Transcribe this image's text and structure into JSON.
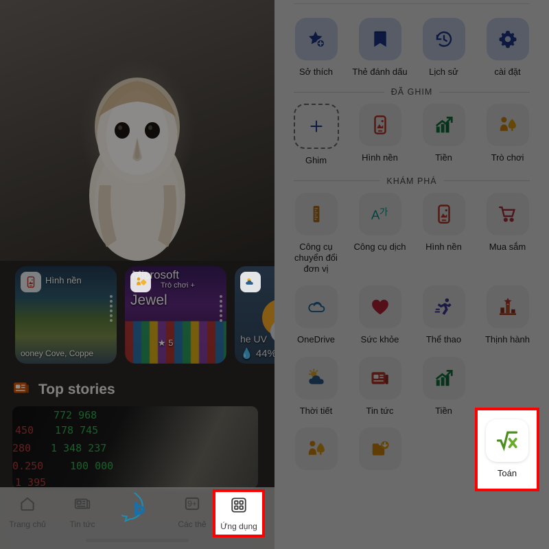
{
  "left": {
    "wallpaper_alt": "barn-owl-photo",
    "cards": [
      {
        "id": "wallpaper-card",
        "badge_icon": "wallpaper-icon",
        "title": "Hình nền",
        "caption": "ooney Cove, Coppe"
      },
      {
        "id": "game-card",
        "badge_icon": "game-icon",
        "brand": "Microsoft",
        "sub": "Trò chơi   +",
        "name": "Jewel",
        "score": "★ 5"
      },
      {
        "id": "weather-card",
        "badge_icon": "weather-icon",
        "uv": "he UV",
        "humidity": "44%"
      }
    ],
    "stories": {
      "icon": "news-icon",
      "label": "Top stories",
      "ticker_values": [
        "772 968",
        "450",
        "178 745",
        "280",
        "1 348 237",
        "0 250",
        "100 000",
        "1 395"
      ]
    },
    "nav": [
      {
        "label": "Trang chủ",
        "icon": "home-icon",
        "badge": ""
      },
      {
        "label": "Tin tức",
        "icon": "news-icon",
        "badge": ""
      },
      {
        "label": "",
        "icon": "bing-logo-icon",
        "badge": ""
      },
      {
        "label": "Các thẻ",
        "icon": "tabs-icon",
        "badge": "9+"
      },
      {
        "label": "Ứng dụng",
        "icon": "apps-grid-icon",
        "badge": ""
      }
    ],
    "highlighted_nav": "Ứng dụng"
  },
  "right": {
    "quick_row": [
      {
        "label": "Sở thích",
        "icon": "star-plus-icon"
      },
      {
        "label": "Thẻ đánh dấu",
        "icon": "bookmark-icon"
      },
      {
        "label": "Lịch sử",
        "icon": "history-icon"
      },
      {
        "label": "cài đặt",
        "icon": "gear-icon"
      }
    ],
    "sections": [
      {
        "title": "ĐÃ GHIM",
        "items": [
          {
            "label": "Ghim",
            "icon": "plus-icon"
          },
          {
            "label": "Hình nền",
            "icon": "wallpaper-icon"
          },
          {
            "label": "Tiền",
            "icon": "money-chart-icon"
          },
          {
            "label": "Trò chơi",
            "icon": "game-icon"
          }
        ]
      },
      {
        "title": "KHÁM PHÁ",
        "rows": [
          [
            {
              "label": "Công cụ chuyển đổi đơn vị",
              "icon": "ruler-icon"
            },
            {
              "label": "Công cụ dịch",
              "icon": "translate-icon"
            },
            {
              "label": "Hình nền",
              "icon": "wallpaper-icon"
            },
            {
              "label": "Mua sắm",
              "icon": "cart-icon"
            }
          ],
          [
            {
              "label": "OneDrive",
              "icon": "onedrive-icon"
            },
            {
              "label": "Sức khỏe",
              "icon": "heart-icon"
            },
            {
              "label": "Thể thao",
              "icon": "runner-icon"
            },
            {
              "label": "Thịnh hành",
              "icon": "trending-podium-icon"
            }
          ],
          [
            {
              "label": "Thời tiết",
              "icon": "weather-icon"
            },
            {
              "label": "Tin tức",
              "icon": "news-icon"
            },
            {
              "label": "Tiền",
              "icon": "money-chart-icon"
            },
            {
              "label": "Toán",
              "icon": "math-sqrt-icon"
            }
          ],
          [
            {
              "label": "",
              "icon": "game-icon"
            },
            {
              "label": "",
              "icon": "download-icon"
            }
          ]
        ]
      }
    ],
    "highlighted_item": "Toán"
  },
  "colors": {
    "highlight": "#ff0000",
    "accent_blue": "#1f3a93",
    "green": "#107c41",
    "orange": "#d98c0a",
    "red": "#c0392b"
  }
}
